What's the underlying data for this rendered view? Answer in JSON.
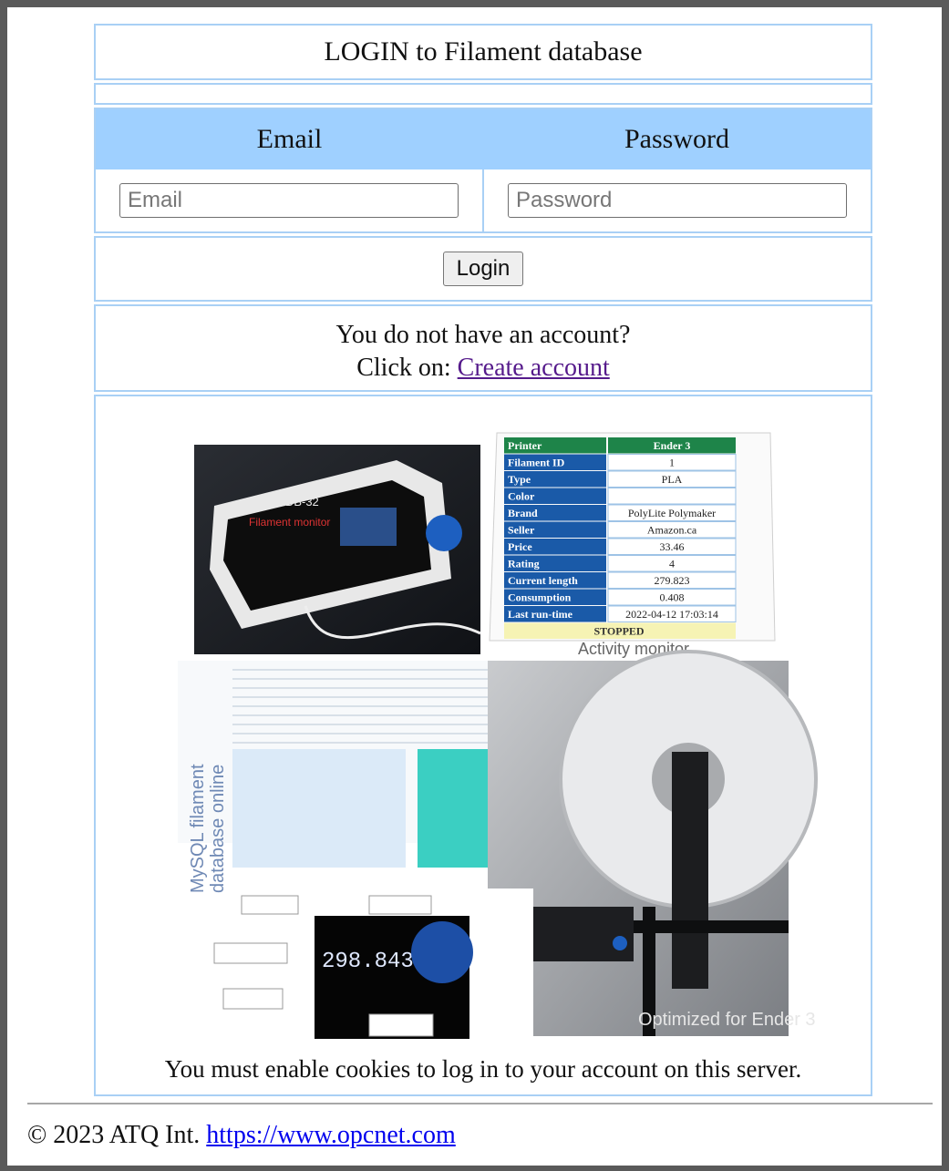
{
  "header": {
    "title": "LOGIN to Filament database"
  },
  "form": {
    "email_label": "Email",
    "password_label": "Password",
    "email_placeholder": "Email",
    "password_placeholder": "Password",
    "email_value": "",
    "password_value": "",
    "login_button": "Login"
  },
  "account": {
    "question": "You do not have an account?",
    "click_on": "Click on:",
    "create_link": "Create account"
  },
  "collage": {
    "device_label": "FDB-32",
    "device_sublabel": "Filament monitor",
    "monitor_table": {
      "header": [
        "Printer",
        "Ender 3"
      ],
      "rows": [
        [
          "Filament ID",
          "1"
        ],
        [
          "Type",
          "PLA"
        ],
        [
          "Color",
          ""
        ],
        [
          "Brand",
          "PolyLite Polymaker"
        ],
        [
          "Seller",
          "Amazon.ca"
        ],
        [
          "Price",
          "33.46"
        ],
        [
          "Rating",
          "4"
        ],
        [
          "Current length",
          "279.823"
        ],
        [
          "Consumption",
          "0.408"
        ],
        [
          "Last run-time",
          "2022-04-12 17:03:14"
        ]
      ],
      "status": "STOPPED"
    },
    "activity_caption": "Activity monitor",
    "mysql_caption_1": "MySQL filament",
    "mysql_caption_2": "database online",
    "display_value": "298.843",
    "spool_caption": "Optimized for Ender 3"
  },
  "notice": {
    "cookies": "You must enable cookies to log in to your account on this server."
  },
  "footer": {
    "copyright": "© 2023 ATQ Int.",
    "link": "https://www.opcnet.com"
  },
  "colors": {
    "header_bg": "#9fd0ff",
    "table_border": "#a9d0f5",
    "monitor_header": "#1e8449",
    "monitor_label_bg": "#1a5aa8",
    "monitor_status_bg": "#f6f3b4",
    "link_visited": "#551a8b",
    "link": "#0000ee"
  }
}
